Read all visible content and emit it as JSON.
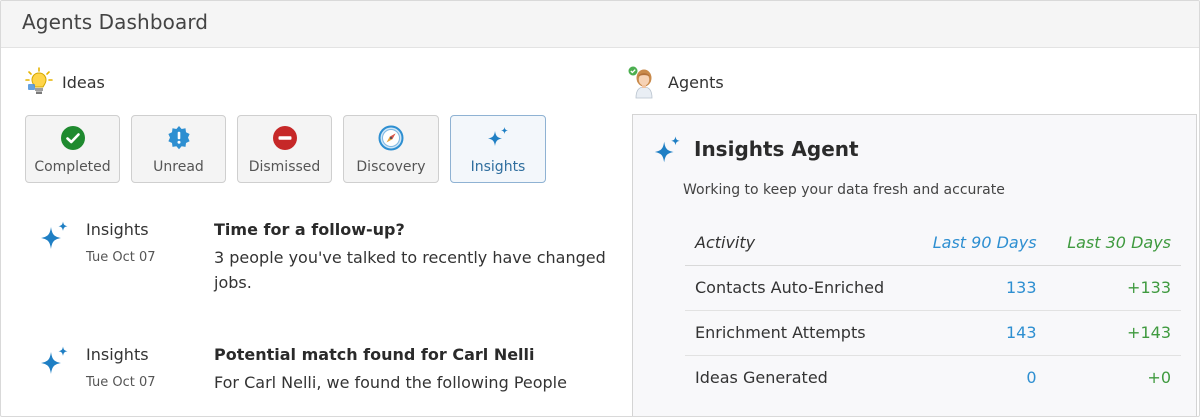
{
  "header": {
    "title": "Agents Dashboard"
  },
  "ideas": {
    "label": "Ideas",
    "icon": "lightbulb-icon",
    "tabs": [
      {
        "label": "Completed",
        "icon": "check-circle-icon",
        "color": "#1f8a2f"
      },
      {
        "label": "Unread",
        "icon": "alert-badge-icon",
        "color": "#2e8fd1"
      },
      {
        "label": "Dismissed",
        "icon": "minus-circle-icon",
        "color": "#c62828"
      },
      {
        "label": "Discovery",
        "icon": "compass-icon",
        "color": "#2e8fd1"
      },
      {
        "label": "Insights",
        "icon": "sparkle-icon",
        "color": "#1f7fc4",
        "active": true
      }
    ],
    "items": [
      {
        "source": "Insights",
        "date": "Tue Oct 07",
        "title": "Time for a follow-up?",
        "description": "3 people you've talked to recently have changed jobs."
      },
      {
        "source": "Insights",
        "date": "Tue Oct 07",
        "title": "Potential match found for Carl Nelli",
        "description": "For Carl Nelli, we found the following People"
      }
    ]
  },
  "agents": {
    "label": "Agents",
    "icon": "agent-avatar-icon",
    "panel": {
      "title": "Insights Agent",
      "subtitle": "Working to keep your data fresh and accurate",
      "columns": [
        "Activity",
        "Last 90 Days",
        "Last 30 Days"
      ],
      "rows": [
        [
          "Contacts Auto-Enriched",
          "133",
          "+133"
        ],
        [
          "Enrichment Attempts",
          "143",
          "+143"
        ],
        [
          "Ideas Generated",
          "0",
          "+0"
        ]
      ]
    }
  },
  "colors": {
    "accent": "#2e8fd1",
    "positive": "#3f9a3f",
    "sparkle": "#1f7fc4"
  }
}
